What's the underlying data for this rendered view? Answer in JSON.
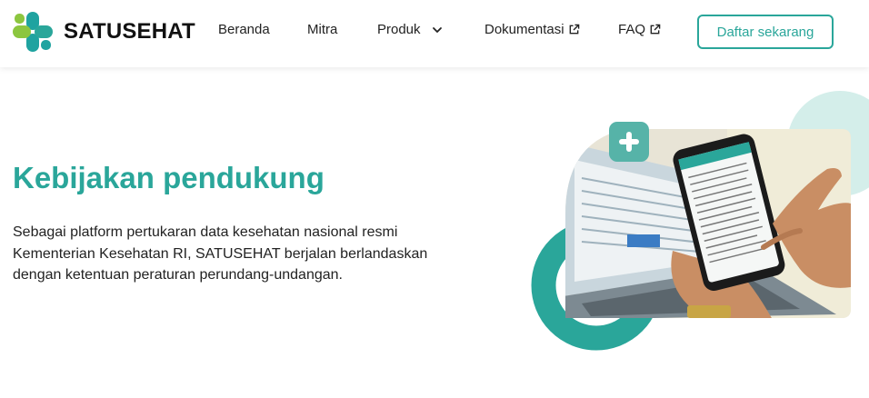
{
  "header": {
    "brand": "SATUSEHAT",
    "nav": [
      {
        "label": "Beranda"
      },
      {
        "label": "Mitra"
      },
      {
        "label": "Produk"
      },
      {
        "label": "Dokumentasi"
      },
      {
        "label": "FAQ"
      }
    ],
    "cta_label": "Daftar sekarang"
  },
  "main": {
    "title": "Kebijakan pendukung",
    "description": "Sebagai platform pertukaran data kesehatan nasional resmi Kementerian Kesehatan RI, SATUSEHAT berjalan berlandaskan dengan ketentuan peraturan perundang-undangan."
  },
  "colors": {
    "accent": "#2aa69a",
    "accent_light": "#d4eeea",
    "logo_green": "#8cc63f",
    "logo_teal": "#1fa3a0"
  }
}
